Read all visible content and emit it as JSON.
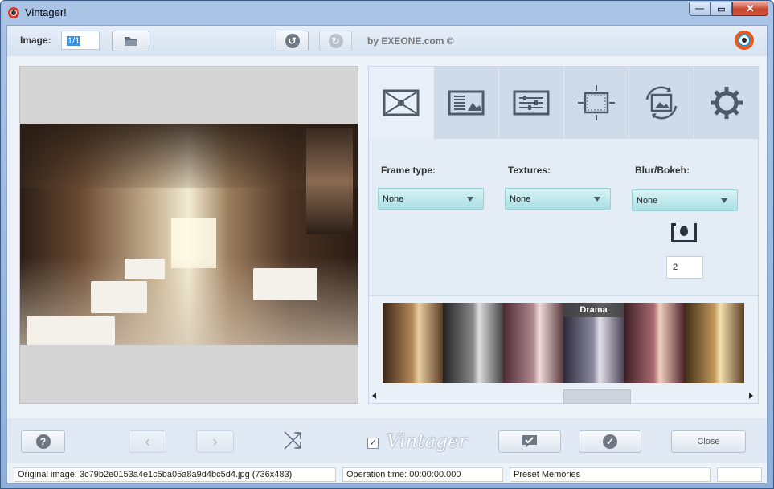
{
  "window": {
    "title": "Vintager!",
    "minimize_glyph": "—",
    "maximize_glyph": "▭",
    "close_glyph": "✕"
  },
  "toolbar": {
    "image_label": "Image:",
    "image_value": "1/1",
    "byline": "by EXEONE.com ©",
    "icons": [
      "open-folder-icon",
      "undo-icon",
      "redo-icon",
      "brand-logo-icon"
    ]
  },
  "tabs": [
    {
      "name": "frames-tab",
      "icon": "envelope-frame-icon"
    },
    {
      "name": "textures-tab",
      "icon": "texture-image-icon"
    },
    {
      "name": "adjustments-tab",
      "icon": "sliders-icon"
    },
    {
      "name": "crop-tab",
      "icon": "crop-resize-icon"
    },
    {
      "name": "rotate-tab",
      "icon": "rotate-image-icon"
    },
    {
      "name": "settings-tab",
      "icon": "gear-icon"
    }
  ],
  "options": {
    "frame_type_label": "Frame type:",
    "frame_type_value": "None",
    "textures_label": "Textures:",
    "textures_value": "None",
    "blur_label": "Blur/Bokeh:",
    "blur_value": "None",
    "blur_amount": "2"
  },
  "presets": {
    "hover_label": "Drama",
    "count_visible": 6
  },
  "bottom": {
    "close_label": "Close",
    "logo_text": "Vintager",
    "checkbox_checked": true
  },
  "status": {
    "original": "Original image: 3c79b2e0153a4e1c5ba05a8a9d4bc5d4.jpg (736x483)",
    "operation_time": "Operation time: 00:00:00.000",
    "preset": "Preset Memories",
    "extra": ""
  },
  "colors": {
    "dropdown": "#a9dfe4",
    "close_button": "#c8452d",
    "brand": "#e85a1b"
  }
}
